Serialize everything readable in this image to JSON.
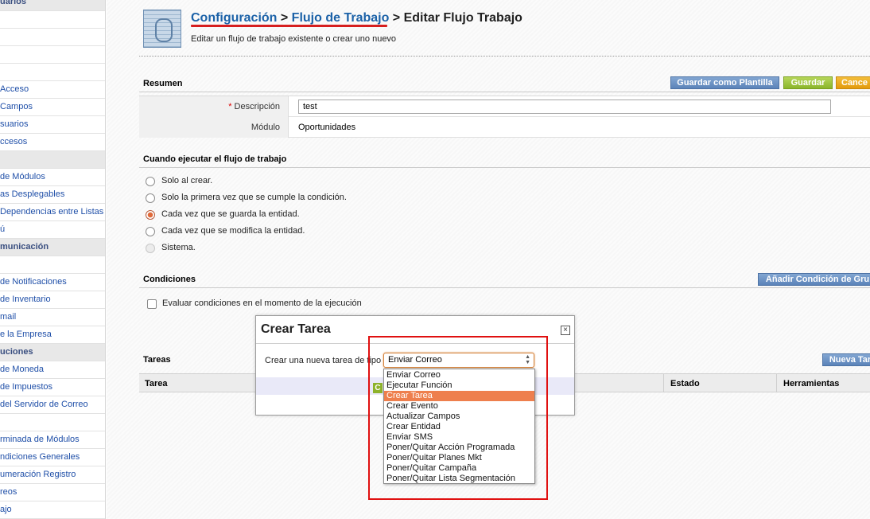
{
  "sidebar": {
    "items": [
      {
        "label": "uarios",
        "head": true
      },
      {
        "label": ""
      },
      {
        "label": ""
      },
      {
        "label": ""
      },
      {
        "label": ""
      },
      {
        "label": "Acceso"
      },
      {
        "label": "Campos"
      },
      {
        "label": "suarios"
      },
      {
        "label": "ccesos"
      },
      {
        "label": "",
        "head": true
      },
      {
        "label": " de Módulos"
      },
      {
        "label": "as Desplegables"
      },
      {
        "label": " Dependencias entre Listas"
      },
      {
        "label": "ú"
      },
      {
        "label": "municación",
        "head": true
      },
      {
        "label": ""
      },
      {
        "label": " de Notificaciones"
      },
      {
        "label": " de Inventario"
      },
      {
        "label": "mail"
      },
      {
        "label": "e la Empresa"
      },
      {
        "label": "uciones",
        "head": true
      },
      {
        "label": " de Moneda"
      },
      {
        "label": " de Impuestos"
      },
      {
        "label": " del Servidor de Correo"
      },
      {
        "label": ""
      },
      {
        "label": "rminada de Módulos"
      },
      {
        "label": "ndiciones Generales"
      },
      {
        "label": "umeración Registro"
      },
      {
        "label": "reos"
      },
      {
        "label": "ajo"
      }
    ]
  },
  "header": {
    "crumb1": "Configuración",
    "sep1": " > ",
    "crumb2": "Flujo de Trabajo",
    "sep2": " > ",
    "current": "Editar Flujo Trabajo",
    "subtitle": "Editar un flujo de trabajo existente o crear uno nuevo"
  },
  "resumen": {
    "title": "Resumen",
    "save_template_label": "Guardar como Plantilla",
    "save_label": "Guardar",
    "cancel_label": "Cance",
    "required_mark": "*",
    "description_label": "Descripción",
    "description_value": "test",
    "module_label": "Módulo",
    "module_value": "Oportunidades"
  },
  "when": {
    "title": "Cuando ejecutar el flujo de trabajo",
    "options": [
      {
        "label": "Solo al crear.",
        "checked": false,
        "disabled": false
      },
      {
        "label": "Solo la primera vez que se cumple la condición.",
        "checked": false,
        "disabled": false
      },
      {
        "label": "Cada vez que se guarda la entidad.",
        "checked": true,
        "disabled": false
      },
      {
        "label": "Cada vez que se modifica la entidad.",
        "checked": false,
        "disabled": false
      },
      {
        "label": "Sistema.",
        "checked": false,
        "disabled": true
      }
    ]
  },
  "conditions": {
    "title": "Condiciones",
    "add_group_label": "Añadir Condición de Gru",
    "evaluate_label": "Evaluar condiciones en el momento de la ejecución"
  },
  "tasks": {
    "title": "Tareas",
    "new_task_label": "Nueva Tar",
    "columns": [
      "Tarea",
      "Estado",
      "Herramientas"
    ]
  },
  "modal": {
    "title": "Crear Tarea",
    "close_glyph": "×",
    "label": "Crear una nueva tarea de tipo",
    "selected_value": "Enviar Correo",
    "button_glyph": "C",
    "options": [
      "Enviar Correo",
      "Ejecutar Función",
      "Crear Tarea",
      "Crear Evento",
      "Actualizar Campos",
      "Crear Entidad",
      "Enviar SMS",
      "Poner/Quitar Acción Programada",
      "Poner/Quitar Planes Mkt",
      "Poner/Quitar Campaña",
      "Poner/Quitar Lista Segmentación"
    ],
    "highlighted_index": 2
  },
  "colors": {
    "link": "#1c62a8",
    "highlight_box": "#e01010",
    "dropdown_selected": "#ee7f4d"
  }
}
